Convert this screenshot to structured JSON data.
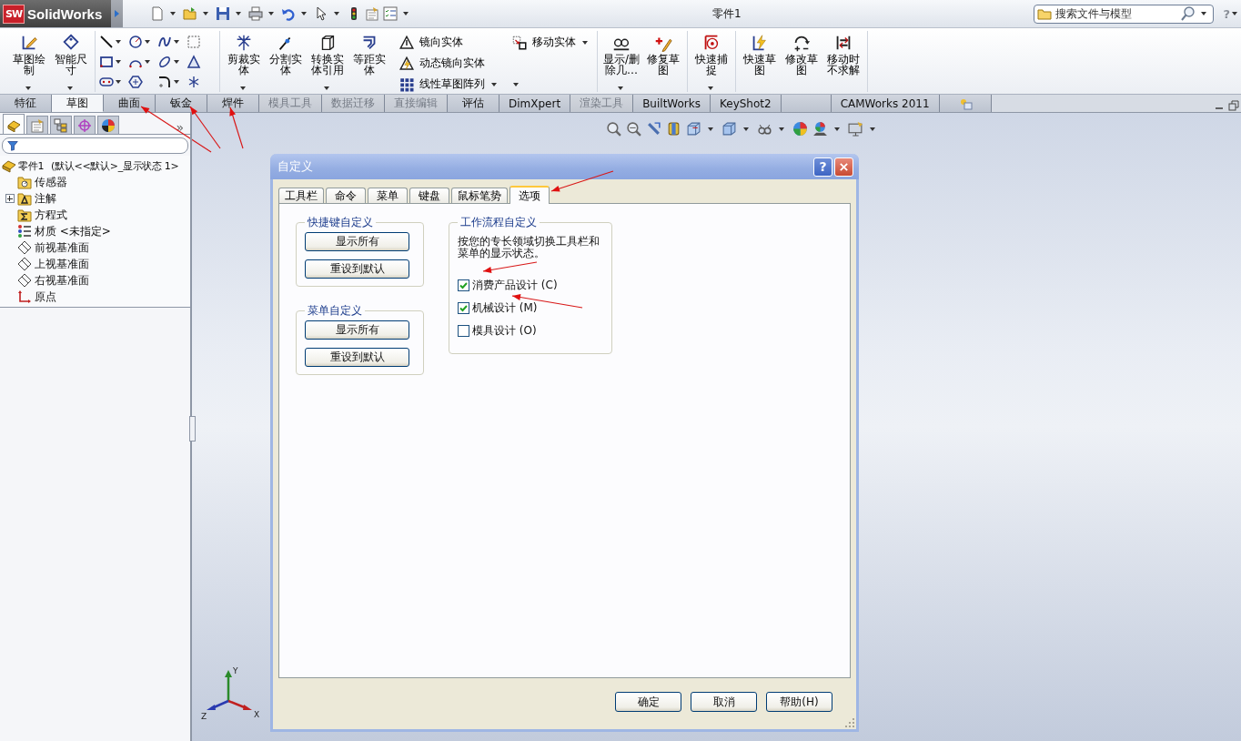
{
  "app": {
    "logo_mark": "SW",
    "logo": "SolidWorks",
    "title": "零件1",
    "search": {
      "placeholder": "搜索文件与模型"
    },
    "help": "?"
  },
  "command_groups": [
    {
      "items": [
        {
          "kind": "large",
          "label": "草图绘制",
          "dropdown": true
        },
        {
          "kind": "large",
          "label": "智能尺寸",
          "dropdown": true
        }
      ]
    },
    {
      "items": [
        {
          "kind": "grid"
        }
      ]
    },
    {
      "items": [
        {
          "kind": "large",
          "label": "剪裁实体",
          "dropdown": true
        },
        {
          "kind": "large",
          "label": "分割实体",
          "dropdown": false
        },
        {
          "kind": "large",
          "label": "转换实体引用",
          "dropdown": true
        },
        {
          "kind": "large",
          "label": "等距实体",
          "dropdown": false
        },
        {
          "kind": "stack",
          "entries": [
            {
              "label": "镜向实体",
              "dropdown": false
            },
            {
              "label": "动态镜向实体",
              "dropdown": false
            },
            {
              "label": "线性草图阵列",
              "dropdown": true
            }
          ]
        },
        {
          "kind": "stack",
          "entries": [
            {
              "label": "移动实体",
              "dropdown": true
            }
          ]
        }
      ]
    },
    {
      "items": [
        {
          "kind": "large",
          "label": "显示/删除几…",
          "dropdown": true
        },
        {
          "kind": "large",
          "label": "修复草图",
          "dropdown": false
        }
      ]
    },
    {
      "items": [
        {
          "kind": "large",
          "label": "快速捕捉",
          "dropdown": true
        }
      ]
    },
    {
      "items": [
        {
          "kind": "large",
          "label": "快速草图",
          "dropdown": false
        },
        {
          "kind": "large",
          "label": "修改草图",
          "dropdown": false
        },
        {
          "kind": "large",
          "label": "移动时不求解",
          "dropdown": false
        }
      ]
    }
  ],
  "tabs": [
    {
      "kind": "text",
      "label": "特征",
      "selected": false,
      "disabled": false
    },
    {
      "kind": "text",
      "label": "草图",
      "selected": true,
      "disabled": false
    },
    {
      "kind": "text",
      "label": "曲面",
      "selected": false,
      "disabled": false
    },
    {
      "kind": "text",
      "label": "钣金",
      "selected": false,
      "disabled": false
    },
    {
      "kind": "text",
      "label": "焊件",
      "selected": false,
      "disabled": false
    },
    {
      "kind": "text",
      "label": "模具工具",
      "selected": false,
      "disabled": true
    },
    {
      "kind": "text",
      "label": "数据迁移",
      "selected": false,
      "disabled": true
    },
    {
      "kind": "text",
      "label": "直接编辑",
      "selected": false,
      "disabled": true
    },
    {
      "kind": "text",
      "label": "评估",
      "selected": false,
      "disabled": false
    },
    {
      "kind": "text",
      "label": "DimXpert",
      "selected": false,
      "disabled": false
    },
    {
      "kind": "text",
      "label": "渲染工具",
      "selected": false,
      "disabled": true
    },
    {
      "kind": "text",
      "label": "BuiltWorks",
      "selected": false,
      "disabled": false
    },
    {
      "kind": "text",
      "label": "KeyShot2",
      "selected": false,
      "disabled": false
    },
    {
      "kind": "blank",
      "selected": false
    },
    {
      "kind": "text",
      "label": "CAMWorks 2011",
      "selected": false,
      "disabled": false
    },
    {
      "kind": "icon",
      "selected": false,
      "disabled": false
    }
  ],
  "feature_panel": {
    "tabs": [
      {
        "selected": true
      },
      {
        "selected": false
      },
      {
        "selected": false
      },
      {
        "selected": false
      },
      {
        "selected": false
      }
    ],
    "more": "»",
    "tree": {
      "label": "零件1",
      "config": "(默认<<默认>_显示状态 1>",
      "children": [
        {
          "kind": "sensor",
          "label": "传感器",
          "collapsed": false
        },
        {
          "kind": "annotation",
          "label": "注解",
          "collapsed": true
        },
        {
          "kind": "equation",
          "label": "方程式",
          "collapsed": false
        },
        {
          "kind": "material",
          "label": "材质 <未指定>",
          "collapsed": false
        },
        {
          "kind": "plane",
          "label": "前视基准面",
          "collapsed": false
        },
        {
          "kind": "plane",
          "label": "上视基准面",
          "collapsed": false
        },
        {
          "kind": "plane",
          "label": "右视基准面",
          "collapsed": false
        },
        {
          "kind": "origin",
          "label": "原点",
          "collapsed": false
        }
      ]
    }
  },
  "triad": {
    "y": "Y",
    "x": "X",
    "z": "Z"
  },
  "dialog": {
    "title": "自定义",
    "help": "?",
    "tabs": [
      {
        "label": "工具栏",
        "selected": false
      },
      {
        "label": "命令",
        "selected": false
      },
      {
        "label": "菜单",
        "selected": false
      },
      {
        "label": "键盘",
        "selected": false
      },
      {
        "label": "鼠标笔势",
        "selected": false
      },
      {
        "label": "选项",
        "selected": true
      }
    ],
    "shortcut_group": {
      "title": "快捷键自定义",
      "buttons": [
        "显示所有",
        "重设到默认"
      ]
    },
    "menu_group": {
      "title": "菜单自定义",
      "buttons": [
        "显示所有",
        "重设到默认"
      ]
    },
    "workflow_group": {
      "title": "工作流程自定义",
      "description": "按您的专长领域切换工具栏和菜单的显示状态。",
      "options": [
        {
          "label": "消费产品设计 (C)",
          "checked": true
        },
        {
          "label": "机械设计 (M)",
          "checked": true
        },
        {
          "label": "模具设计 (O)",
          "checked": false
        }
      ]
    },
    "buttons": [
      "确定",
      "取消",
      "帮助(H)"
    ]
  }
}
